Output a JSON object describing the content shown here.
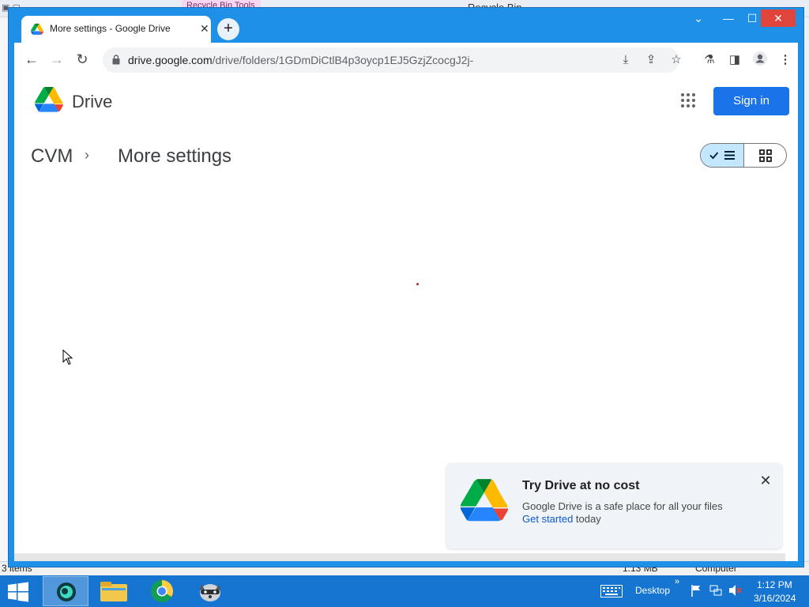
{
  "background_window": {
    "ribbon_tab": "Recycle Bin Tools",
    "title": "Recycle Bin",
    "status_items": "3 items",
    "status_size": "1.13 MB",
    "status_location": "Computer"
  },
  "browser": {
    "tab": {
      "title": "More settings - Google Drive",
      "favicon": "drive-logo-icon"
    },
    "window_controls": [
      "tab-search",
      "minimize",
      "maximize",
      "close"
    ],
    "url": {
      "host": "drive.google.com",
      "path": "/drive/folders/1GDmDiCtlB4p3oycp1EJ5GzjZcocgJ2j-"
    },
    "toolbar_icons": [
      "install-icon",
      "share-icon",
      "bookmark-star-icon",
      "labs-icon",
      "side-panel-icon",
      "profile-icon",
      "menu-icon"
    ]
  },
  "drive": {
    "logo_text": "Drive",
    "sign_in": "Sign in",
    "breadcrumb": {
      "root": "CVM",
      "separator": "›",
      "current": "More settings"
    },
    "view_toggle": {
      "selected": "list"
    }
  },
  "promo": {
    "title": "Try Drive at no cost",
    "body": "Google Drive is a safe place for all your files",
    "link": "Get started",
    "link_suffix": " today"
  },
  "taskbar": {
    "desktop_label": "Desktop",
    "time": "1:12 PM",
    "date": "3/16/2024",
    "pinned": [
      "app-icon",
      "file-explorer-icon",
      "chrome-icon",
      "raccoon-icon"
    ]
  },
  "colors": {
    "chrome_frame": "#1e90e8",
    "sign_in_button": "#1a73e8",
    "taskbar": "#1675d1",
    "close_button": "#e0443a"
  }
}
